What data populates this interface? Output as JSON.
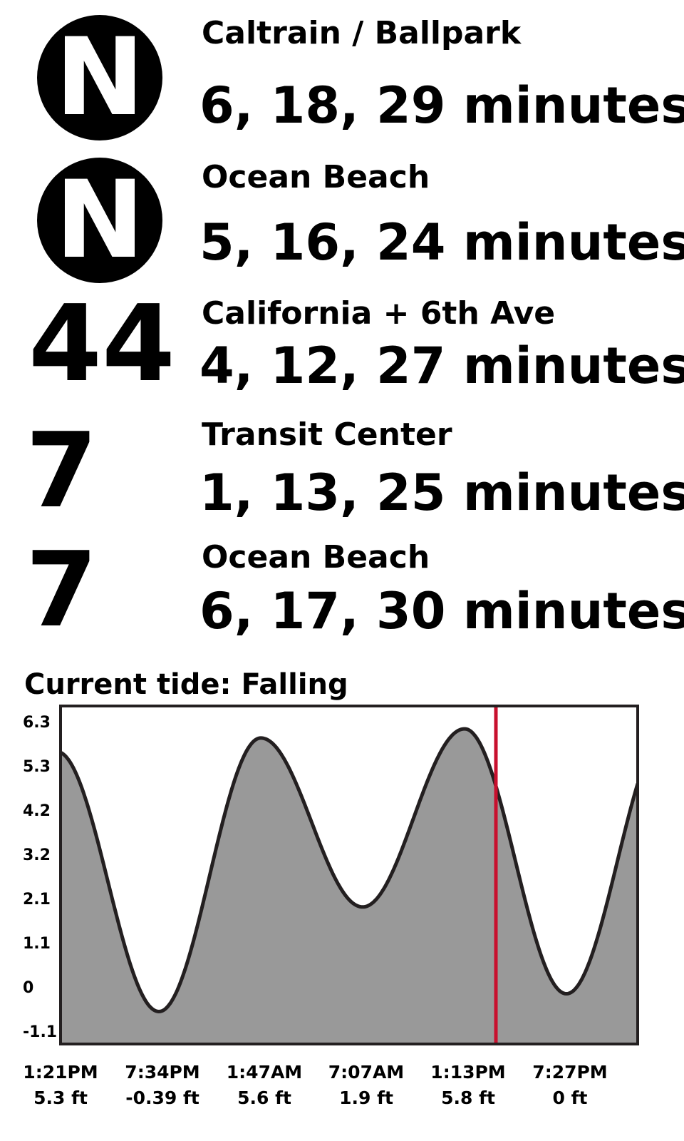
{
  "predictions": [
    {
      "route": "N",
      "style": "badge",
      "destination": "Caltrain / Ballpark",
      "times": "6, 18, 29 minutes"
    },
    {
      "route": "N",
      "style": "badge",
      "destination": "Ocean Beach",
      "times": "5, 16, 24 minutes"
    },
    {
      "route": "44",
      "style": "number",
      "destination": "California + 6th Ave",
      "times": "4, 12, 27 minutes"
    },
    {
      "route": "7",
      "style": "number",
      "destination": "Transit Center",
      "times": "1, 13, 25 minutes"
    },
    {
      "route": "7",
      "style": "number",
      "destination": "Ocean Beach",
      "times": "6, 17, 30 minutes"
    }
  ],
  "tide": {
    "title": "Current tide: Falling"
  },
  "colors": {
    "fill": "#999999",
    "stroke": "#231f20",
    "now_line": "#c8102e"
  },
  "chart_data": {
    "type": "area",
    "title": "Current tide: Falling",
    "xlabel": "",
    "ylabel": "",
    "ylim": [
      -1.1,
      6.3
    ],
    "yticks": [
      "6.3",
      "5.3",
      "4.2",
      "3.2",
      "2.1",
      "1.1",
      "0",
      "-1.1"
    ],
    "extremes": [
      {
        "time": "1:21PM",
        "height": 5.3,
        "label": "5.3 ft"
      },
      {
        "time": "7:34PM",
        "height": -0.39,
        "label": "-0.39 ft"
      },
      {
        "time": "1:47AM",
        "height": 5.6,
        "label": "5.6 ft"
      },
      {
        "time": "7:07AM",
        "height": 1.9,
        "label": "1.9 ft"
      },
      {
        "time": "1:13PM",
        "height": 5.8,
        "label": "5.8 ft"
      },
      {
        "time": "7:27PM",
        "height": 0,
        "label": "0 ft"
      }
    ],
    "now_marker": "falling, between 1:13PM and 7:27PM",
    "grid": false,
    "legend": "none"
  }
}
